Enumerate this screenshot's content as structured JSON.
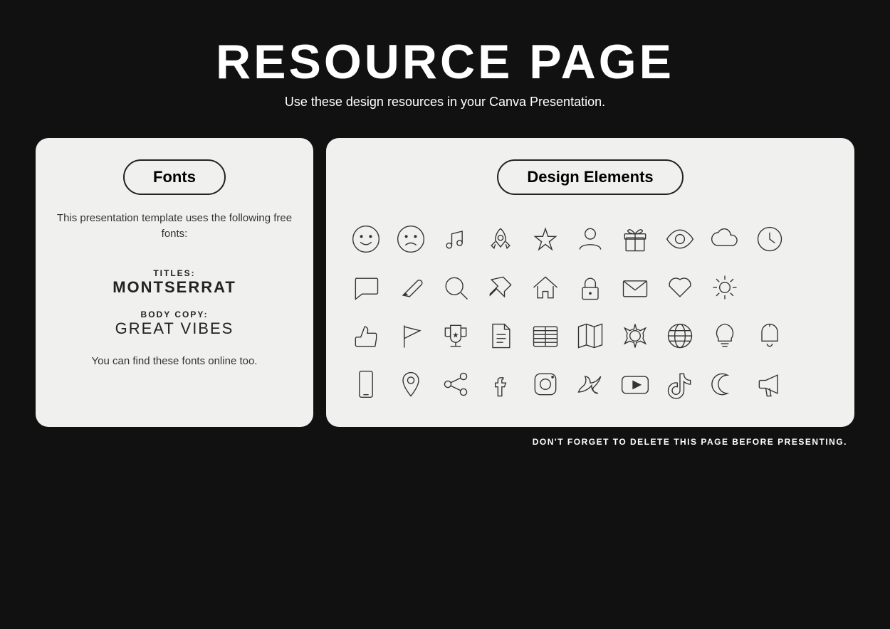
{
  "header": {
    "title": "RESOURCE PAGE",
    "subtitle": "Use these design resources in your Canva Presentation."
  },
  "fonts_panel": {
    "title": "Fonts",
    "intro": "This presentation template uses the following free fonts:",
    "titles_label": "TITLES:",
    "titles_font": "MONTSERRAT",
    "body_label": "BODY COPY:",
    "body_font": "GREAT VIBES",
    "footer": "You can find these fonts online too."
  },
  "design_panel": {
    "title": "Design Elements"
  },
  "footer": {
    "note": "DON'T FORGET TO DELETE THIS PAGE BEFORE PRESENTING."
  }
}
